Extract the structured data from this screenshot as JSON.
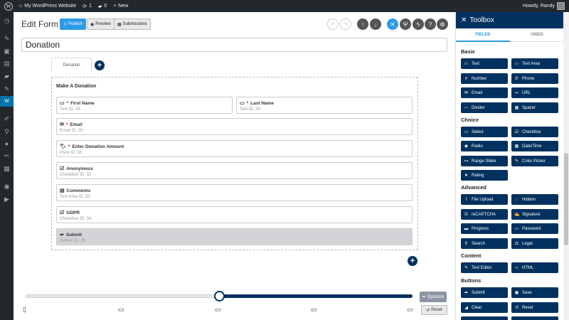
{
  "admin_bar": {
    "site_name": "My WordPress Website",
    "updates_count": "1",
    "comments_count": "0",
    "new_label": "New",
    "howdy": "Howdy, Randy"
  },
  "header": {
    "title": "Edit Form",
    "publish": "Publish",
    "preview": "Preview",
    "submissions": "Submissions"
  },
  "form_name": "Donation",
  "tabs": [
    "Donation"
  ],
  "canvas_title": "Make A Donation",
  "fields": [
    {
      "icon": "▭",
      "req": "*",
      "label": "First Name",
      "sub": "Text   ID: 28"
    },
    {
      "icon": "▭",
      "req": "*",
      "label": "Last Name",
      "sub": "Text   ID: 29"
    },
    {
      "icon": "✉",
      "req": "*",
      "label": "Email",
      "sub": "Email   ID: 30"
    },
    {
      "icon": "🏷",
      "req": "*",
      "label": "Enter Donation Amount",
      "sub": "Price   ID: 31"
    },
    {
      "icon": "☑",
      "req": "",
      "label": "Anonymous",
      "sub": "Checkbox   ID: 32"
    },
    {
      "icon": "▤",
      "req": "",
      "label": "Comments",
      "sub": "Text Area   ID: 33"
    },
    {
      "icon": "☑",
      "req": "",
      "label": "GDPR",
      "sub": "Checkbox   ID: 34"
    },
    {
      "icon": "➦",
      "req": "",
      "label": "Submit",
      "sub": "Submit   ID: 35"
    }
  ],
  "bottom": {
    "optimize": "Optimize",
    "reset": "Reset",
    "slider_fraction": 0.5
  },
  "toolbox": {
    "title": "Toolbox",
    "tabs": [
      "FIELDS",
      "UNDO"
    ],
    "sections": {
      "basic": "Basic",
      "choice": "Choice",
      "advanced": "Advanced",
      "content": "Content",
      "buttons": "Buttons"
    },
    "basic": [
      "Text",
      "Text Area",
      "Number",
      "Phone",
      "Email",
      "URL",
      "Divider",
      "Spacer"
    ],
    "choice": [
      "Select",
      "Checkbox",
      "Radio",
      "Date/Time",
      "Range Slider",
      "Color Picker",
      "Rating"
    ],
    "advanced": [
      "File Upload",
      "Hidden",
      "reCAPTCHA",
      "Signature",
      "Progress",
      "Password",
      "Search",
      "Legal"
    ],
    "content": [
      "Text Editor",
      "HTML"
    ],
    "buttons": [
      "Submit",
      "Save",
      "Clear",
      "Reset"
    ]
  },
  "colors": {
    "navy": "#00315f",
    "blue": "#2e9be6",
    "admin_dark": "#23282d"
  }
}
